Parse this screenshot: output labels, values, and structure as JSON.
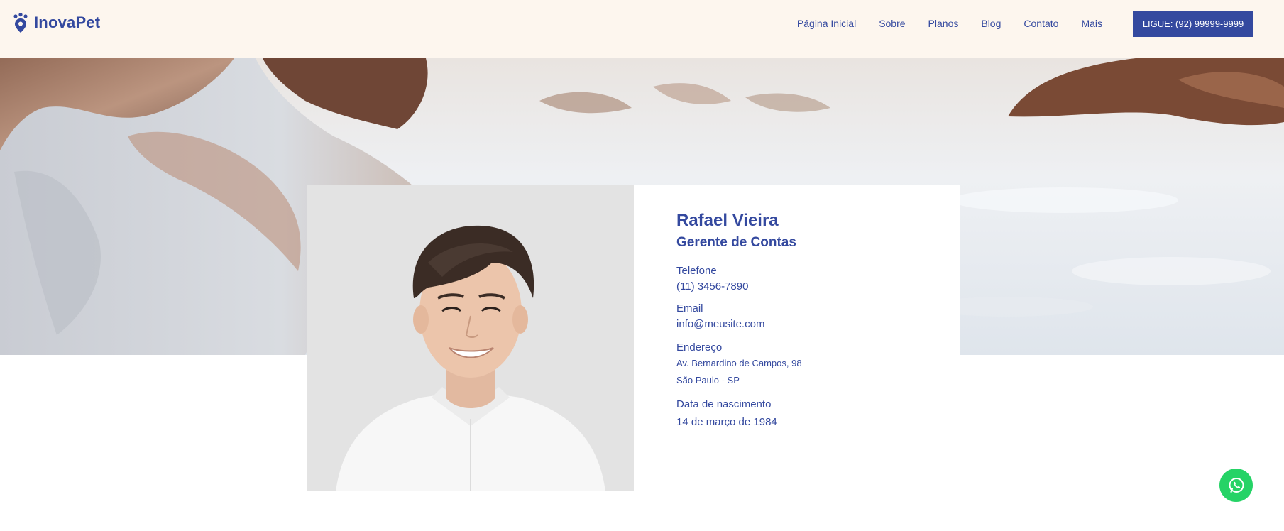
{
  "header": {
    "logo_text": "InovaPet",
    "nav": [
      "Página Inicial",
      "Sobre",
      "Planos",
      "Blog",
      "Contato",
      "Mais"
    ],
    "cta_label": "LIGUE: (92) 99999-9999"
  },
  "profile": {
    "name": "Rafael Vieira",
    "role": "Gerente de Contas",
    "phone_label": "Telefone",
    "phone_value": "(11) 3456-7890",
    "email_label": "Email",
    "email_value": "info@meusite.com",
    "address_label": "Endereço",
    "address_line1": "Av. Bernardino de Campos, 98",
    "address_line2": "São Paulo - SP",
    "birth_label": "Data de nascimento",
    "birth_value": "14 de março de 1984"
  },
  "icons": {
    "logo": "paw-pin-icon",
    "whatsapp": "whatsapp-icon"
  },
  "colors": {
    "brand": "#34499f",
    "header_bg": "#fdf6ee",
    "whatsapp": "#25d366"
  }
}
